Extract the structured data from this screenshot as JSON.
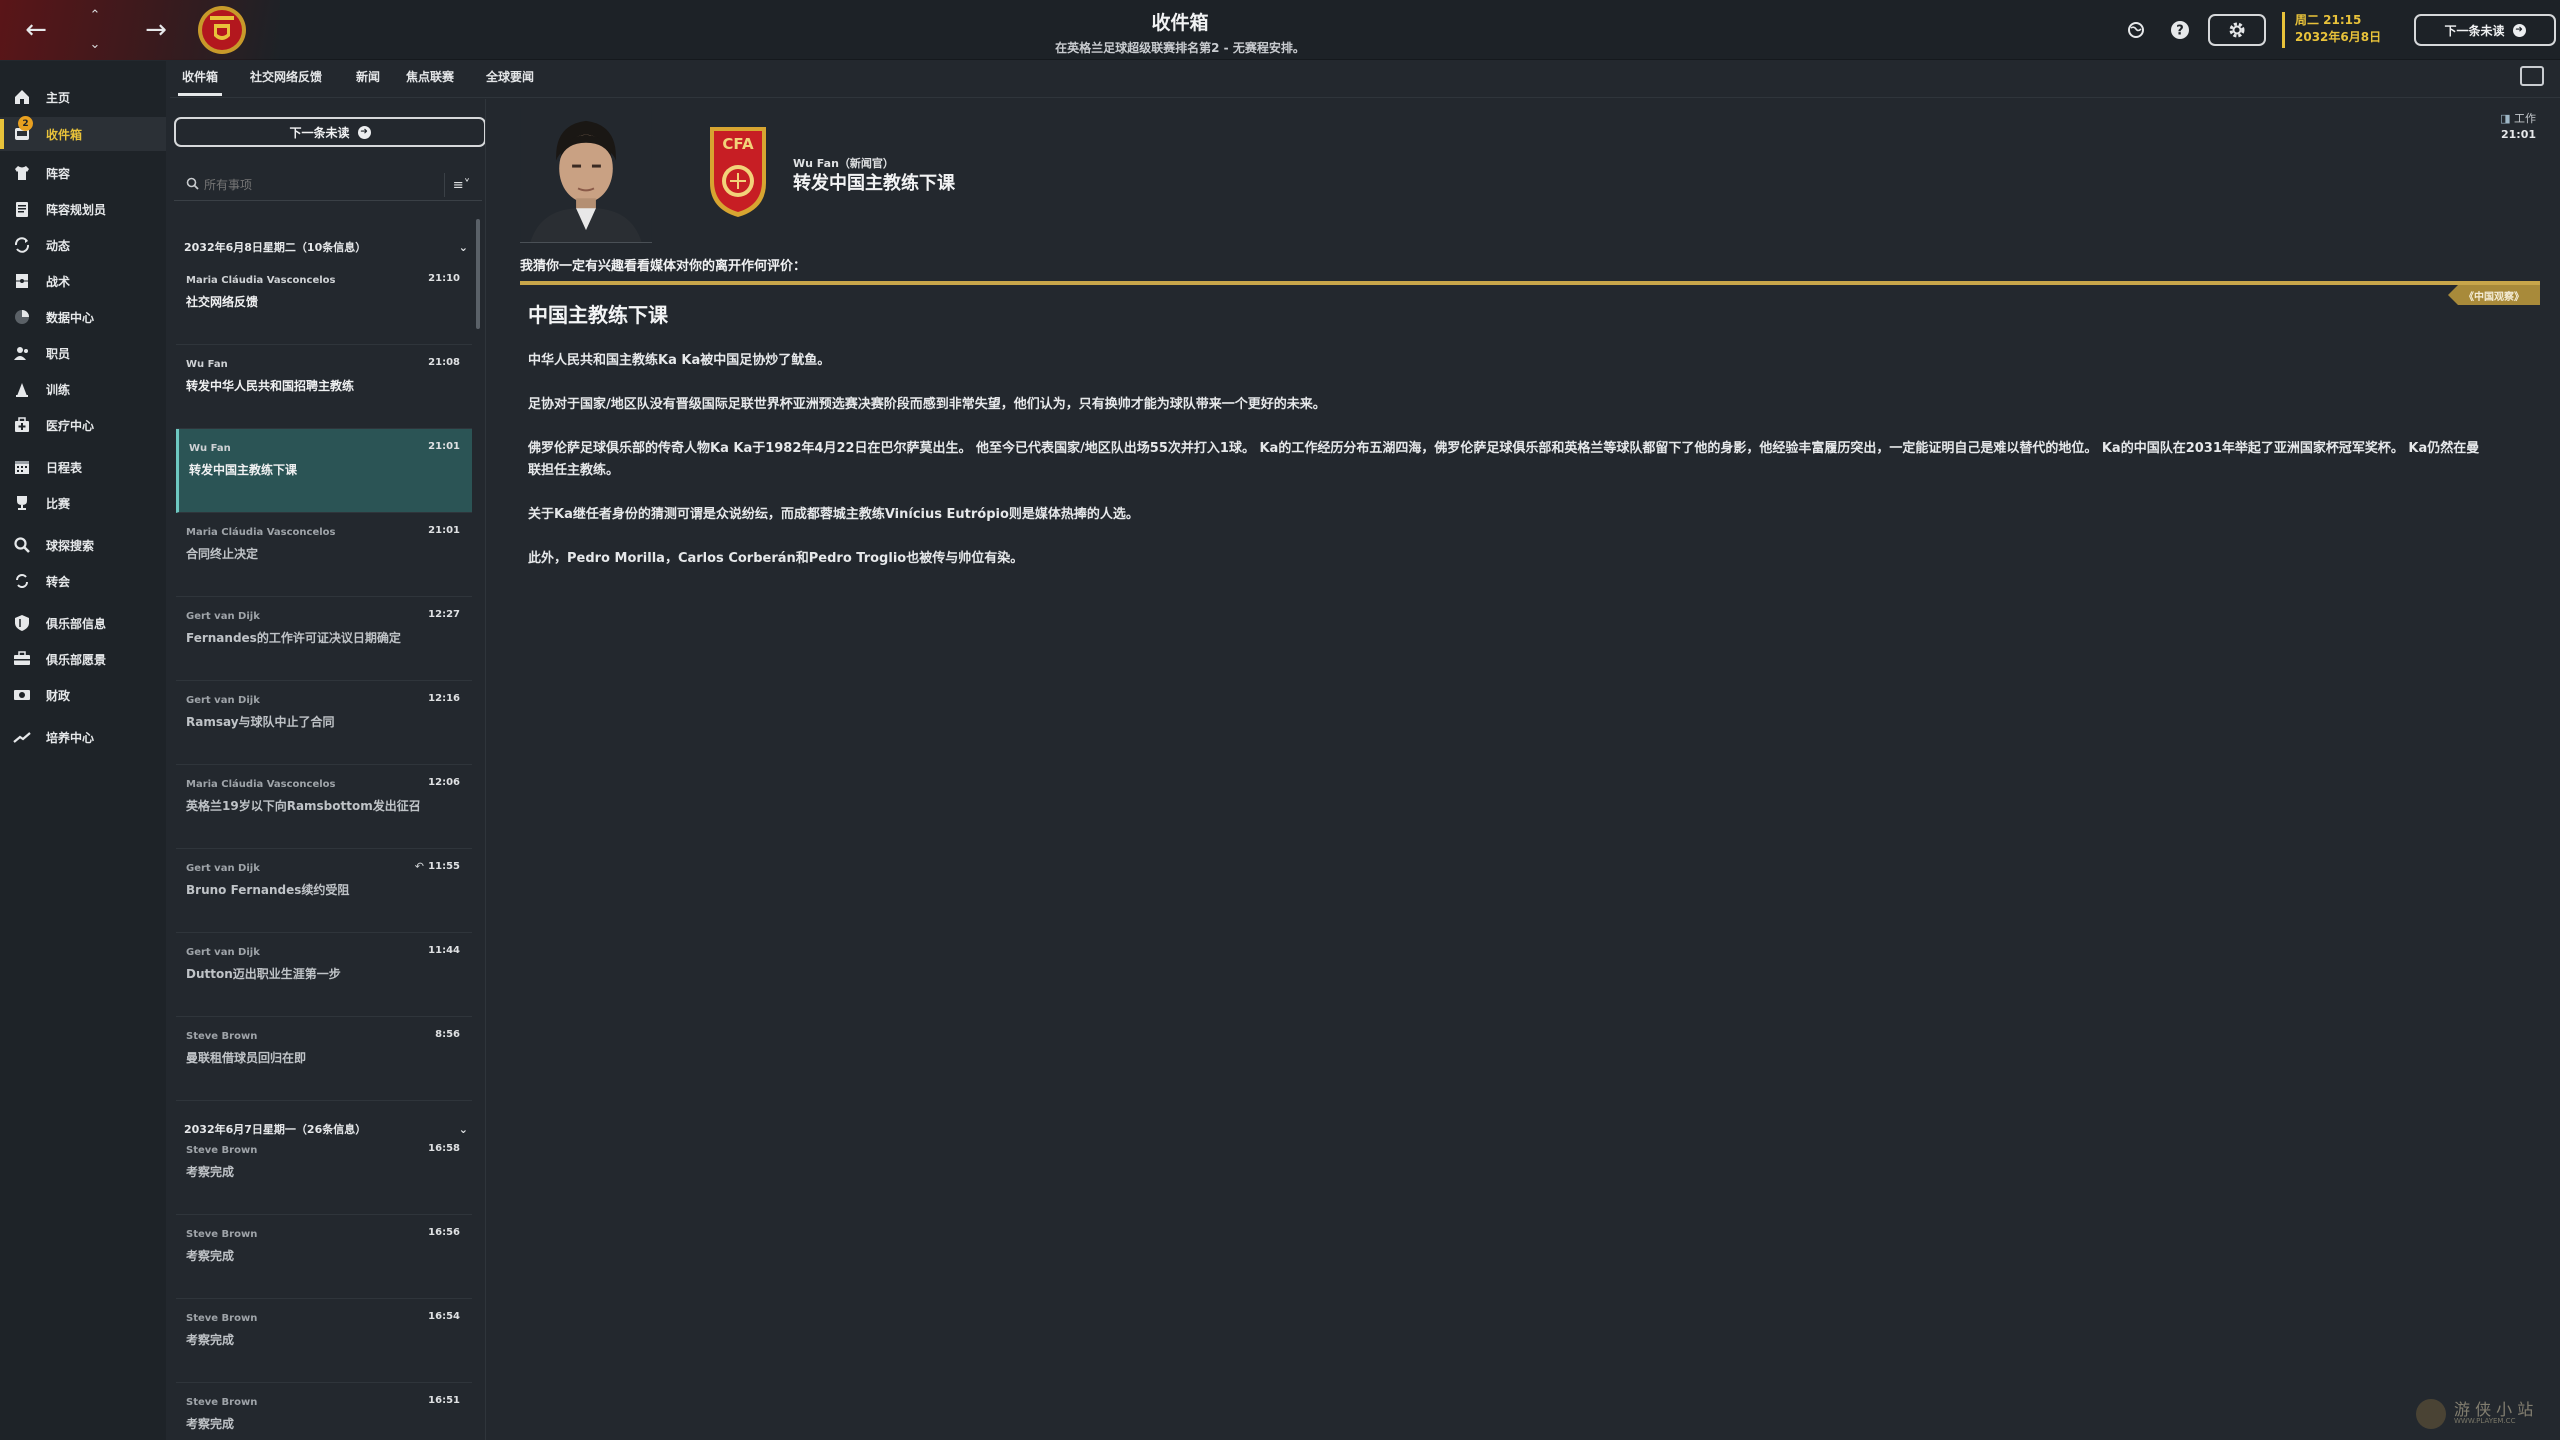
{
  "header": {
    "title": "收件箱",
    "subtitle": "在英格兰足球超级联赛排名第2 - 无赛程安排。",
    "date_line1": "周二 21:15",
    "date_line2": "2032年6月8日",
    "continue_label": "下一条未读"
  },
  "sidebar": {
    "items": [
      {
        "label": "主页",
        "icon": "home-icon"
      },
      {
        "label": "收件箱",
        "icon": "inbox-icon",
        "badge": "2"
      },
      {
        "label": "阵容",
        "icon": "shirt-icon"
      },
      {
        "label": "阵容规划员",
        "icon": "clipboard-icon"
      },
      {
        "label": "动态",
        "icon": "dynamics-icon"
      },
      {
        "label": "战术",
        "icon": "tactics-icon"
      },
      {
        "label": "数据中心",
        "icon": "data-icon"
      },
      {
        "label": "职员",
        "icon": "staff-icon"
      },
      {
        "label": "训练",
        "icon": "training-icon"
      },
      {
        "label": "医疗中心",
        "icon": "medical-icon"
      },
      {
        "label": "日程表",
        "icon": "calendar-icon"
      },
      {
        "label": "比赛",
        "icon": "trophy-icon"
      },
      {
        "label": "球探搜索",
        "icon": "scout-icon"
      },
      {
        "label": "转会",
        "icon": "transfer-icon"
      },
      {
        "label": "俱乐部信息",
        "icon": "shield-icon"
      },
      {
        "label": "俱乐部愿景",
        "icon": "vision-icon"
      },
      {
        "label": "财政",
        "icon": "finance-icon"
      },
      {
        "label": "培养中心",
        "icon": "development-icon"
      }
    ]
  },
  "tabs": [
    "收件箱",
    "社交网络反馈",
    "新闻",
    "焦点联赛",
    "全球要闻"
  ],
  "list": {
    "continue_label": "下一条未读",
    "search_placeholder": "所有事项",
    "group1": "2032年6月8日星期二（10条信息）",
    "group2": "2032年6月7日星期一（26条信息）",
    "messages1": [
      {
        "sender": "Maria Cláudia Vasconcelos",
        "time": "21:10",
        "subject": "社交网络反馈"
      },
      {
        "sender": "Wu Fan",
        "time": "21:08",
        "subject": "转发中华人民共和国招聘主教练"
      },
      {
        "sender": "Wu Fan",
        "time": "21:01",
        "subject": "转发中国主教练下课"
      },
      {
        "sender": "Maria Cláudia Vasconcelos",
        "time": "21:01",
        "subject": "合同终止决定"
      },
      {
        "sender": "Gert van Dijk",
        "time": "12:27",
        "subject": "Fernandes的工作许可证决议日期确定"
      },
      {
        "sender": "Gert van Dijk",
        "time": "12:16",
        "subject": "Ramsay与球队中止了合同"
      },
      {
        "sender": "Maria Cláudia Vasconcelos",
        "time": "12:06",
        "subject": "英格兰19岁以下向Ramsbottom发出征召"
      },
      {
        "sender": "Gert van Dijk",
        "time": "11:55",
        "subject": "Bruno Fernandes续约受阻"
      },
      {
        "sender": "Gert van Dijk",
        "time": "11:44",
        "subject": "Dutton迈出职业生涯第一步"
      },
      {
        "sender": "Steve Brown",
        "time": "8:56",
        "subject": "曼联租借球员回归在即"
      }
    ],
    "messages2": [
      {
        "sender": "Steve Brown",
        "time": "16:58",
        "subject": "考察完成"
      },
      {
        "sender": "Steve Brown",
        "time": "16:56",
        "subject": "考察完成"
      },
      {
        "sender": "Steve Brown",
        "time": "16:54",
        "subject": "考察完成"
      },
      {
        "sender": "Steve Brown",
        "time": "16:51",
        "subject": "考察完成"
      }
    ]
  },
  "reader": {
    "from": "Wu Fan（新闻官）",
    "title": "转发中国主教练下课",
    "emblem_text": "CFA",
    "meta_category": "工作",
    "meta_time": "21:01",
    "intro": "我猜你一定有兴趣看看媒体对你的离开作何评价：",
    "source_tag": "《中国观察》",
    "article_title": "中国主教练下课",
    "paragraphs": [
      "中华人民共和国主教练Ka Ka被中国足协炒了鱿鱼。",
      "足协对于国家/地区队没有晋级国际足联世界杯亚洲预选赛决赛阶段而感到非常失望，他们认为，只有换帅才能为球队带来一个更好的未来。",
      "佛罗伦萨足球俱乐部的传奇人物Ka Ka于1982年4月22日在巴尔萨莫出生。 他至今已代表国家/地区队出场55次并打入1球。 Ka的工作经历分布五湖四海，佛罗伦萨足球俱乐部和英格兰等球队都留下了他的身影，他经验丰富履历突出，一定能证明自己是难以替代的地位。 Ka的中国队在2031年举起了亚洲国家杯冠军奖杯。 Ka仍然在曼联担任主教练。",
      "关于Ka继任者身份的猜测可谓是众说纷纭，而成都蓉城主教练Vinícius Eutrópio则是媒体热捧的人选。",
      "此外，Pedro Morilla，Carlos Corberán和Pedro Troglio也被传与帅位有染。"
    ]
  },
  "watermark": {
    "text": "游 侠 小 站",
    "sub": "WWW.PLAYEM.CC"
  },
  "colors": {
    "accent_gold": "#e8c23a",
    "selected_teal": "#2b5455",
    "rule_gold": "#c8a64a"
  }
}
